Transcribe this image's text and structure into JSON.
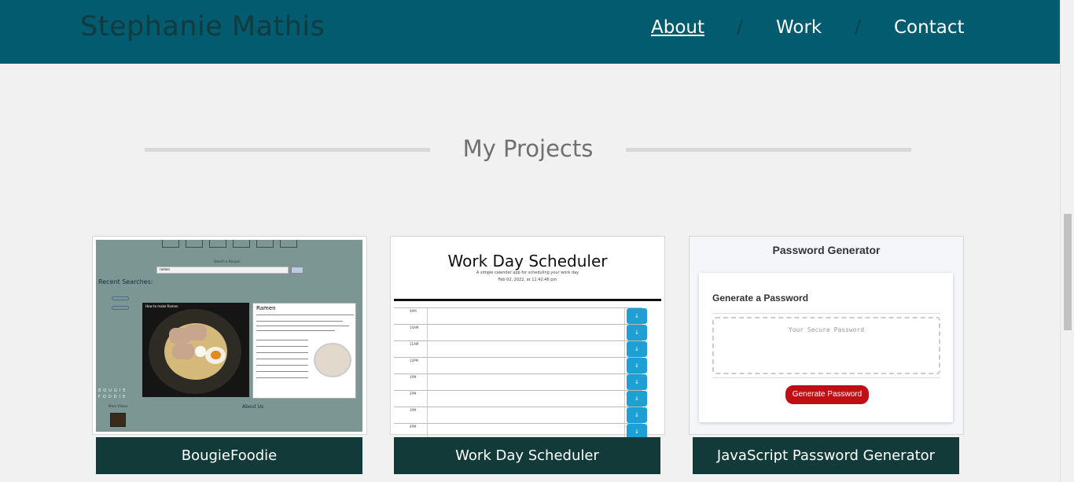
{
  "header": {
    "brand": "Stephanie Mathis",
    "nav": [
      {
        "label": "About"
      },
      {
        "separator": "/"
      },
      {
        "label": "Work"
      },
      {
        "separator": "/"
      },
      {
        "label": "Contact"
      }
    ]
  },
  "section": {
    "title": "My Projects"
  },
  "projects": [
    {
      "caption": "BougieFoodie",
      "thumbnail": {
        "search_label": "Search a Recipe!",
        "search_value": "ramen",
        "recent_searches": "Recent Searches:",
        "video_title": "How to make Ramen",
        "wiki_title": "Ramen",
        "about": "About Us",
        "more_videos": "More Videos",
        "logo_letters": "BOUGIE FOODIE"
      }
    },
    {
      "caption": "Work Day Scheduler",
      "thumbnail": {
        "title": "Work Day Scheduler",
        "subtitle": "A simple calendar app for scheduling your work day",
        "date": "Feb 02, 2022, at 11:42:46 pm",
        "hours": [
          "9AM",
          "10AM",
          "11AM",
          "12PM",
          "1PM",
          "2PM",
          "3PM",
          "4PM"
        ]
      }
    },
    {
      "caption": "JavaScript Password Generator",
      "thumbnail": {
        "title": "Password Generator",
        "heading": "Generate a Password",
        "placeholder": "Your Secure Password",
        "button": "Generate Password"
      }
    }
  ],
  "colors": {
    "header_bg": "#025b6e",
    "caption_bg": "#123a38",
    "page_bg": "#f1f1f1"
  }
}
